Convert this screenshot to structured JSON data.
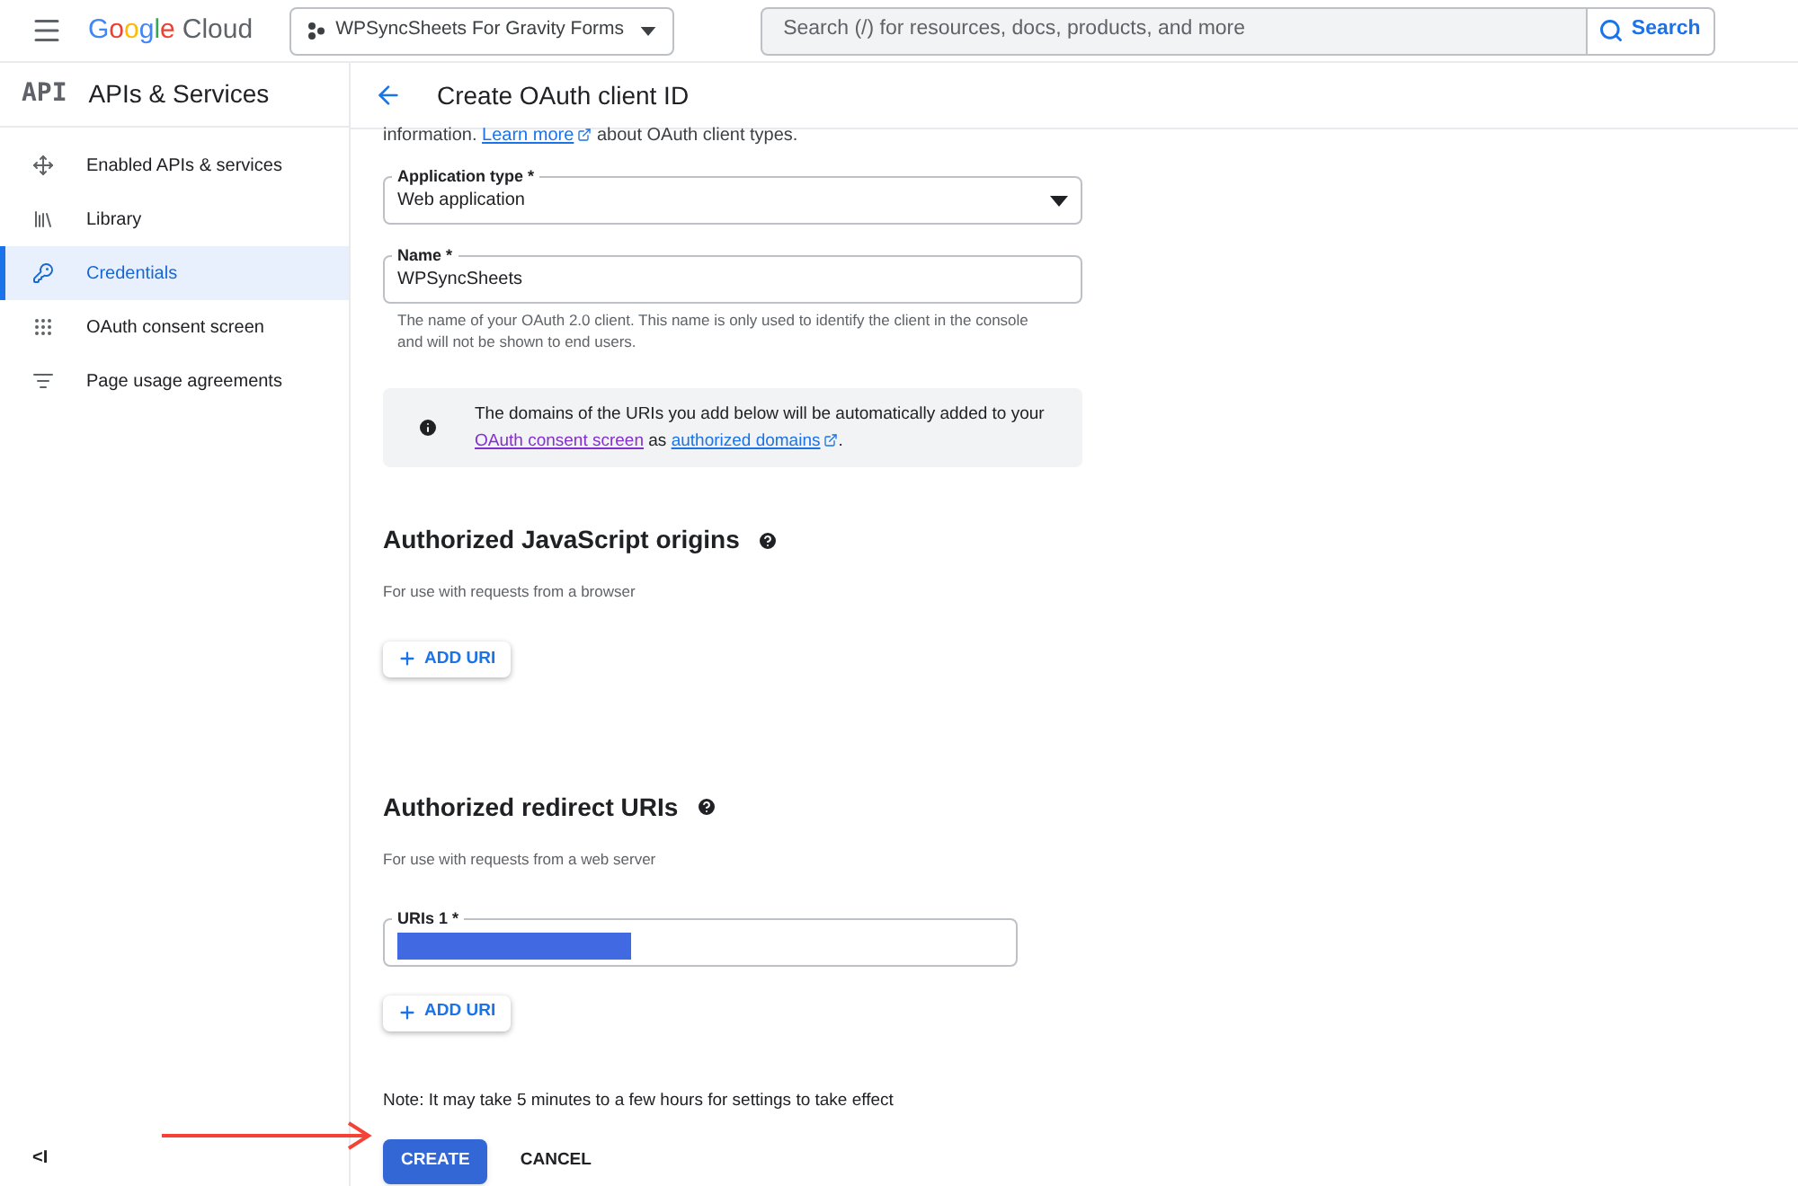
{
  "topbar": {
    "logo_google": "Google",
    "logo_cloud": "Cloud",
    "project": "WPSyncSheets For Gravity Forms",
    "search": {
      "placeholder": "Search (/) for resources, docs, products, and more"
    },
    "search_button": "Search"
  },
  "sidebar": {
    "badge": "API",
    "title": "APIs & Services",
    "items": [
      {
        "label": "Enabled APIs & services",
        "kind": "move",
        "selected": false
      },
      {
        "label": "Library",
        "kind": "library",
        "selected": false
      },
      {
        "label": "Credentials",
        "kind": "key",
        "selected": true
      },
      {
        "label": "OAuth consent screen",
        "kind": "consent",
        "selected": false
      },
      {
        "label": "Page usage agreements",
        "kind": "agreements",
        "selected": false
      }
    ],
    "collapse": "<I"
  },
  "page": {
    "title": "Create OAuth client ID",
    "intro": {
      "before": "information.",
      "link": "Learn more",
      "after": "about OAuth client types."
    },
    "app_type": {
      "label": "Application type *",
      "value": "Web application"
    },
    "name": {
      "label": "Name *",
      "value": "WPSyncSheets",
      "help": "The name of your OAuth 2.0 client. This name is only used to identify the client in the console and will not be shown to end users."
    },
    "info": {
      "text": "The domains of the URIs you add below will be automatically added to your",
      "link1": "OAuth consent screen",
      "middle": "as",
      "link2": "authorized domains",
      "end": "."
    },
    "js_origins": {
      "heading": "Authorized JavaScript origins",
      "sub": "For use with requests from a browser",
      "add": "ADD URI"
    },
    "redirects": {
      "heading": "Authorized redirect URIs",
      "sub": "For use with requests from a web server",
      "uri_label": "URIs 1 *",
      "add": "ADD URI"
    },
    "note": "Note: It may take 5 minutes to a few hours for settings to take effect",
    "create": "CREATE",
    "cancel": "CANCEL"
  }
}
